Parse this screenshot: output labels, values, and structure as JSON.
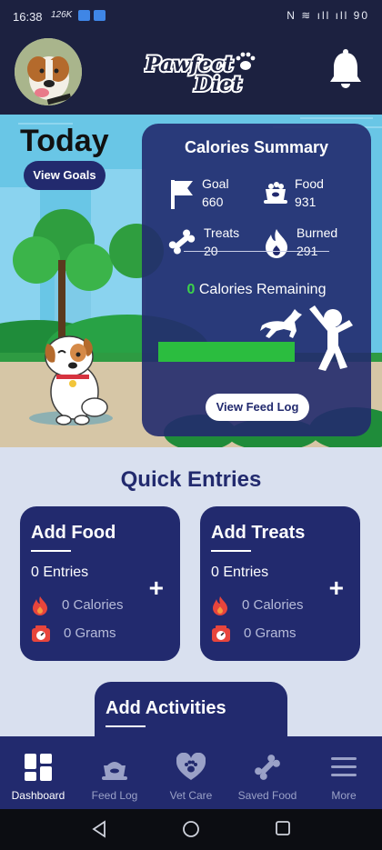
{
  "status_bar": {
    "time": "16:38",
    "speed": "126K",
    "battery": "90"
  },
  "header": {
    "logo_line1": "Pawfect",
    "logo_line2": "Diet",
    "avatar_icon": "dog-avatar",
    "bell_icon": "bell-icon"
  },
  "hero": {
    "title": "Today",
    "view_goals": "View Goals"
  },
  "summary": {
    "title": "Calories Summary",
    "goal_label": "Goal",
    "goal_value": "660",
    "food_label": "Food",
    "food_value": "931",
    "treats_label": "Treats",
    "treats_value": "20",
    "burned_label": "Burned",
    "burned_value": "291",
    "remaining_value": "0",
    "remaining_label": "Calories Remaining",
    "progress_fraction": 1.0,
    "view_feed_log": "View Feed Log"
  },
  "quick_entries": {
    "title": "Quick Entries",
    "add_food": {
      "title": "Add Food",
      "entries": "0 Entries",
      "calories": "0 Calories",
      "grams": "0 Grams"
    },
    "add_treats": {
      "title": "Add Treats",
      "entries": "0 Entries",
      "calories": "0 Calories",
      "grams": "0 Grams"
    },
    "add_activities": {
      "title": "Add Activities"
    }
  },
  "nav": {
    "items": [
      {
        "label": "Dashboard",
        "icon": "dashboard-icon"
      },
      {
        "label": "Feed Log",
        "icon": "bowl-icon"
      },
      {
        "label": "Vet Care",
        "icon": "paw-heart-icon"
      },
      {
        "label": "Saved Food",
        "icon": "bone-icon"
      },
      {
        "label": "More",
        "icon": "menu-icon"
      }
    ]
  },
  "colors": {
    "navy": "#222a6e",
    "header": "#1c2140",
    "green": "#2bbd3f",
    "background": "#d9e0ef"
  }
}
